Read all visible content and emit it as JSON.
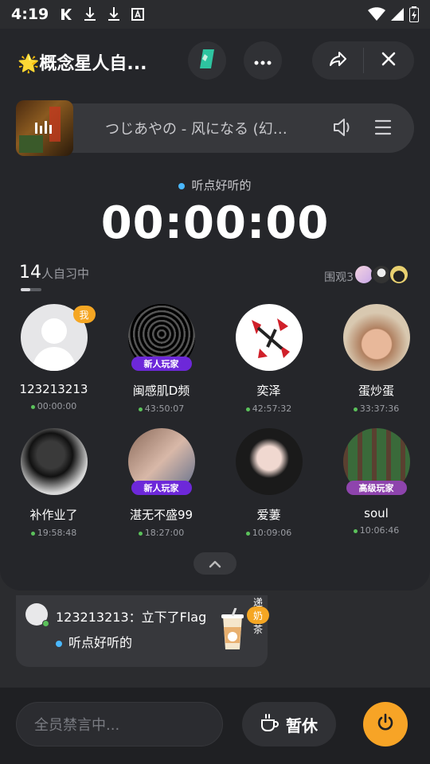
{
  "status_bar": {
    "time": "4:19",
    "icons": [
      "k-app-icon",
      "download-icon",
      "download-icon",
      "a-app-icon"
    ],
    "right_icons": [
      "wifi-icon",
      "signal-icon",
      "battery-icon"
    ]
  },
  "header": {
    "title": "🌟概念星人自..."
  },
  "music": {
    "song": "つじあやの - 风になる (幻化..."
  },
  "study": {
    "mode_label": "听点好听的",
    "timer": "00:00:00",
    "count_number": "14",
    "count_text": "人自习中",
    "watch_label": "围观3"
  },
  "users": [
    {
      "name": "123213213",
      "time": "00:00:00",
      "is_me": true,
      "me_label": "我",
      "badge": ""
    },
    {
      "name": "闽感肌D频",
      "time": "43:50:07",
      "badge": "新人玩家"
    },
    {
      "name": "奕泽",
      "time": "42:57:32",
      "badge": ""
    },
    {
      "name": "蛋炒蛋",
      "time": "33:37:36",
      "badge": ""
    },
    {
      "name": "补作业了",
      "time": "19:58:48",
      "badge": ""
    },
    {
      "name": "湛无不盛99",
      "time": "18:27:00",
      "badge": "新人玩家"
    },
    {
      "name": "爱萋",
      "time": "10:09:06",
      "badge": ""
    },
    {
      "name": "soul",
      "time": "10:06:46",
      "badge": "高级玩家"
    }
  ],
  "feed": {
    "line": "123213213：立下了Flag",
    "sub": "听点好听的",
    "tag": "递奶茶"
  },
  "bottom": {
    "input_placeholder": "全员禁言中...",
    "rest_label": "暂休"
  },
  "colors": {
    "accent": "#f7a426",
    "online": "#5bc25b",
    "mode_dot": "#4ab8ff",
    "badge_new": "#7c3aed",
    "badge_senior": "#8e44ad"
  }
}
